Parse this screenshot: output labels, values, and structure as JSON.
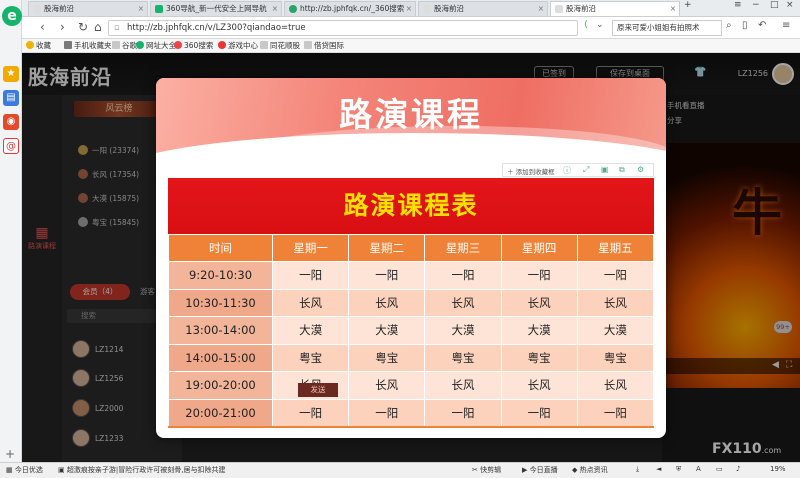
{
  "browser": {
    "tabs": [
      {
        "label": "股海前沿",
        "active": false
      },
      {
        "label": "360导航_新一代安全上网导航",
        "active": false
      },
      {
        "label": "http://zb.jphfqk.cn/_360搜索",
        "active": false
      },
      {
        "label": "股海前沿",
        "active": false
      },
      {
        "label": "股海前沿",
        "active": true
      }
    ],
    "url": "http://zb.jphfqk.cn/v/LZ300?qiandao=true",
    "search_text": "原来可爱小姐姐有拍照术",
    "bookmarks": [
      "收藏",
      "手机收藏夹",
      "谷歌",
      "网址大全",
      "360搜索",
      "游戏中心",
      "同花顺股",
      "借贷国际"
    ]
  },
  "site": {
    "brand": "股海前沿",
    "signed_in_label": "已签到",
    "save_desktop_label": "保存到桌面",
    "username": "LZ1256",
    "rank_header": "风云榜",
    "left_link": "路演课程",
    "ranking": [
      {
        "name": "一阳",
        "score": "(23374)"
      },
      {
        "name": "长风",
        "score": "(17354)"
      },
      {
        "name": "大漠",
        "score": "(15875)"
      },
      {
        "name": "粤宝",
        "score": "(15845)"
      }
    ],
    "members_tab": "会员（4）",
    "visitors_tab": "游客",
    "search_placeholder": "搜索",
    "members": [
      "LZ1214",
      "LZ1256",
      "LZ2000",
      "LZ1233"
    ],
    "send_label": "发送",
    "live_label": "手机看直播",
    "share_label": "分享",
    "video_char": "牛",
    "badge_count": "99+"
  },
  "modal": {
    "title": "路演课程",
    "tool_add": "添加到收藏框",
    "table_title": "路演课程表",
    "columns": [
      "时间",
      "星期一",
      "星期二",
      "星期三",
      "星期四",
      "星期五"
    ],
    "rows": [
      {
        "time": "9:20-10:30",
        "days": [
          "一阳",
          "一阳",
          "一阳",
          "一阳",
          "一阳"
        ]
      },
      {
        "time": "10:30-11:30",
        "days": [
          "长风",
          "长风",
          "长风",
          "长风",
          "长风"
        ]
      },
      {
        "time": "13:00-14:00",
        "days": [
          "大漠",
          "大漠",
          "大漠",
          "大漠",
          "大漠"
        ]
      },
      {
        "time": "14:00-15:00",
        "days": [
          "粤宝",
          "粤宝",
          "粤宝",
          "粤宝",
          "粤宝"
        ]
      },
      {
        "time": "19:00-20:00",
        "days": [
          "长风",
          "长风",
          "长风",
          "长风",
          "长风"
        ]
      },
      {
        "time": "20:00-21:00",
        "days": [
          "一阳",
          "一阳",
          "一阳",
          "一阳",
          "一阳"
        ]
      }
    ]
  },
  "watermark": {
    "brand": "FX110",
    "domain": ".com"
  },
  "statusbar": {
    "left_label": "今日优选",
    "news": "超激痕按亲子游|冒险行政许可被刻骨,居与扣除共建",
    "items": [
      "快剪辑",
      "今日直播",
      "热点资讯"
    ],
    "zoom": "19%"
  },
  "colors": {
    "accent_red": "#e3161a",
    "banner_yellow": "#ffe100",
    "header_orange": "#ef8236",
    "brand_green": "#16b36b"
  }
}
